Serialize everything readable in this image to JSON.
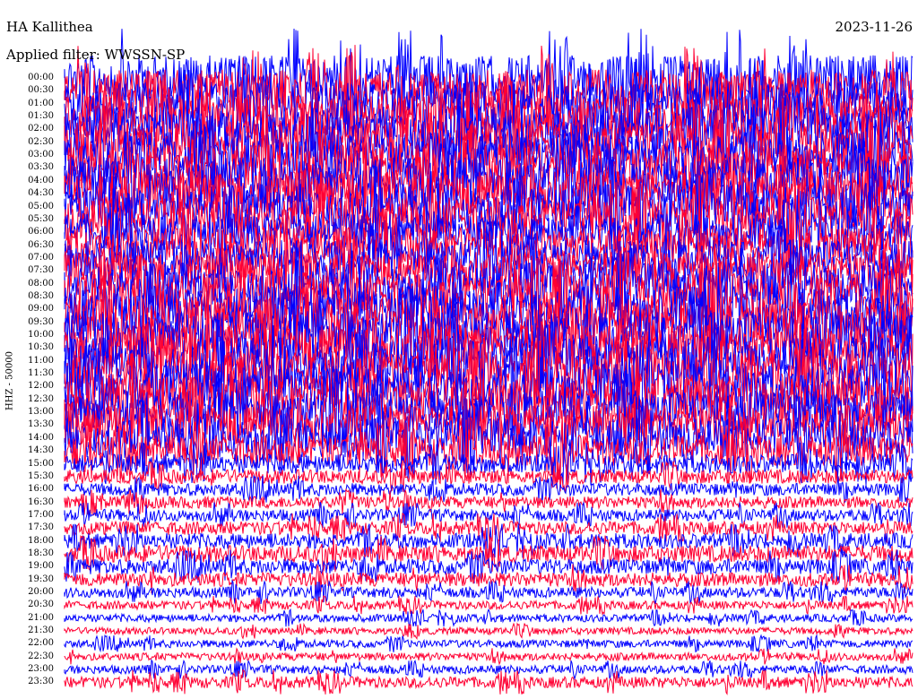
{
  "header": {
    "station": "HA Kallithea",
    "filter_label": "Applied filter: WWSSN-SP",
    "date": "2023-11-26"
  },
  "chart_data": {
    "type": "line",
    "title": "HA Kallithea",
    "ylabel": "HHZ - 50000",
    "trace_colors": [
      "#0000ff",
      "#ff0033"
    ],
    "time_labels": [
      "00:00",
      "00:30",
      "01:00",
      "01:30",
      "02:00",
      "02:30",
      "03:00",
      "03:30",
      "04:00",
      "04:30",
      "05:00",
      "05:30",
      "06:00",
      "06:30",
      "07:00",
      "07:30",
      "08:00",
      "08:30",
      "09:00",
      "09:30",
      "10:00",
      "10:30",
      "11:00",
      "11:30",
      "12:00",
      "12:30",
      "13:00",
      "13:30",
      "14:00",
      "14:30",
      "15:00",
      "15:30",
      "16:00",
      "16:30",
      "17:00",
      "17:30",
      "18:00",
      "18:30",
      "19:00",
      "19:30",
      "20:00",
      "20:30",
      "21:00",
      "21:30",
      "22:00",
      "22:30",
      "23:00",
      "23:30"
    ],
    "relative_noise_amplitude": [
      3.2,
      3.0,
      3.1,
      3.0,
      3.2,
      3.1,
      3.3,
      3.4,
      3.4,
      3.3,
      3.2,
      3.1,
      2.6,
      2.5,
      2.6,
      2.8,
      3.0,
      3.2,
      3.3,
      3.4,
      3.5,
      3.4,
      3.3,
      3.4,
      3.3,
      3.2,
      3.1,
      3.0,
      2.8,
      2.2,
      1.4,
      1.0,
      0.9,
      0.85,
      0.85,
      0.95,
      1.1,
      1.2,
      1.1,
      1.0,
      0.75,
      0.6,
      0.55,
      0.5,
      0.55,
      0.55,
      0.6,
      0.8
    ]
  }
}
